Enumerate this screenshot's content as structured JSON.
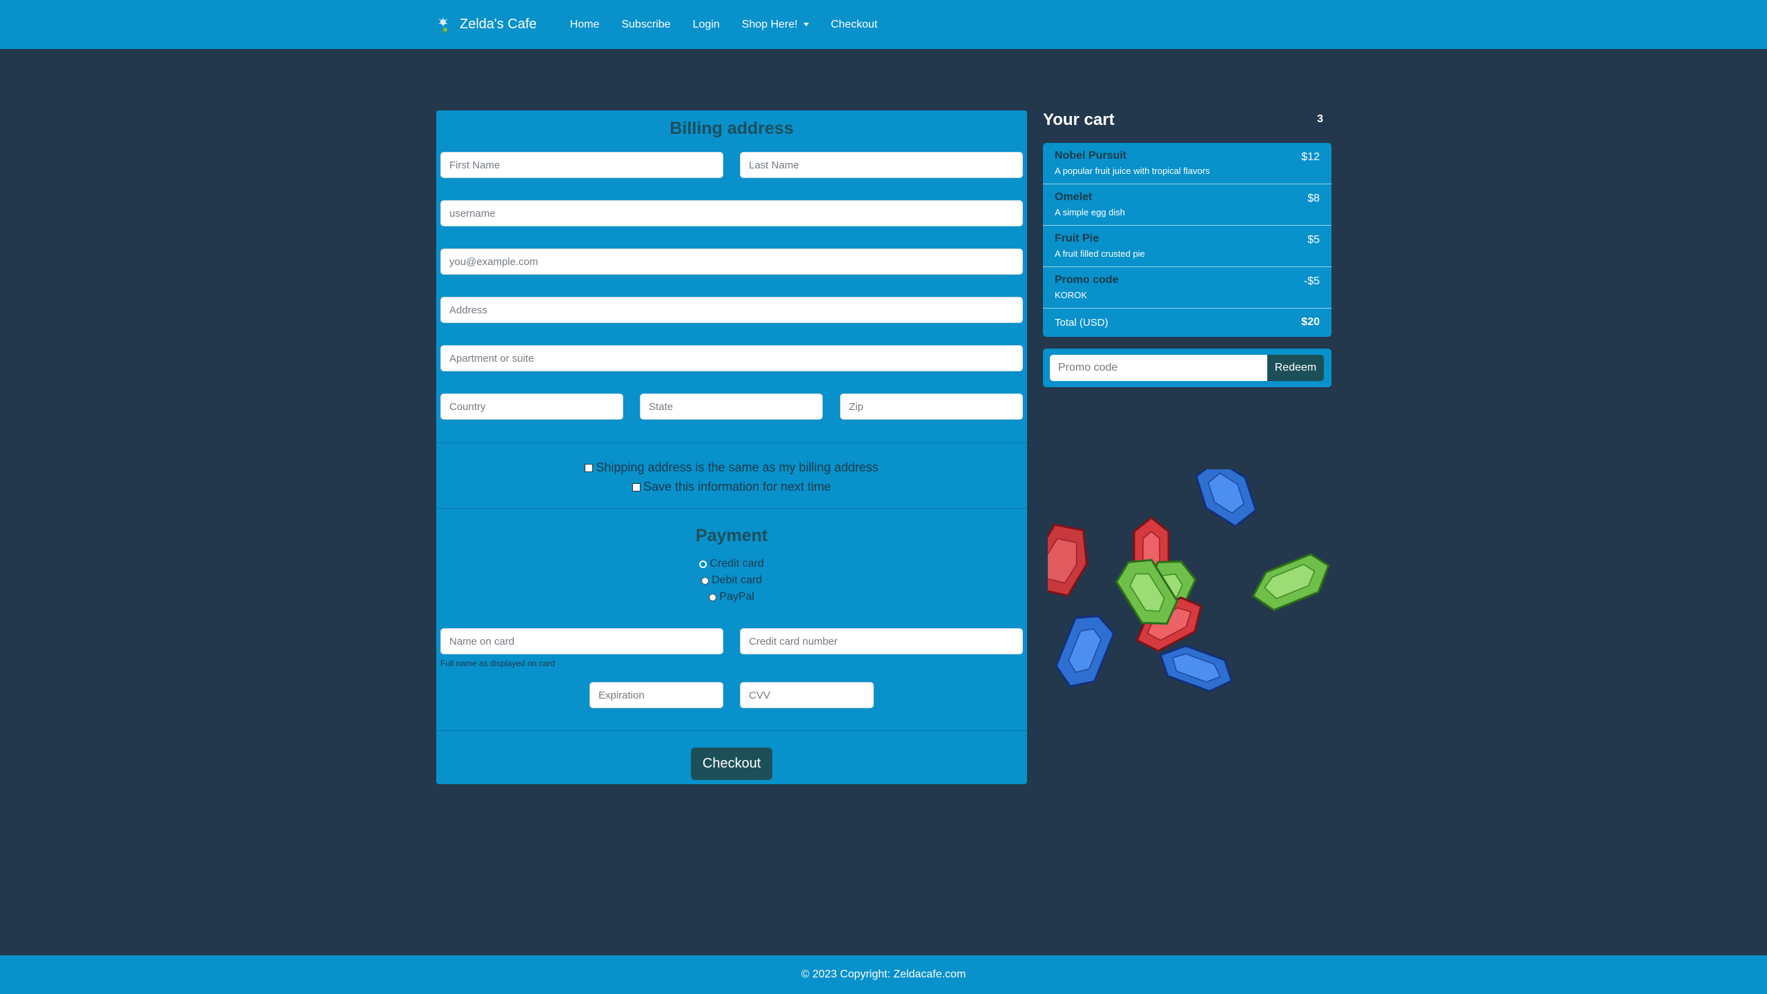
{
  "nav": {
    "brand": "Zelda's Cafe",
    "links": [
      "Home",
      "Subscribe",
      "Login",
      "Shop Here!",
      "Checkout"
    ]
  },
  "billing": {
    "title": "Billing address",
    "first_name": "First Name",
    "last_name": "Last Name",
    "username": "username",
    "email": "you@example.com",
    "address": "Address",
    "address2": "Apartment or suite",
    "country": "Country",
    "state": "State",
    "zip": "Zip",
    "same_address": "Shipping address is the same as my billing address",
    "save_info": "Save this information for next time"
  },
  "payment": {
    "title": "Payment",
    "methods": [
      "Credit card",
      "Debit card",
      "PayPal"
    ],
    "selected": "Credit card",
    "name_on_card": "Name on card",
    "name_help": "Full name as displayed on card",
    "card_number": "Credit card number",
    "expiration": "Expiration",
    "cvv": "CVV",
    "checkout": "Checkout"
  },
  "cart": {
    "title": "Your cart",
    "count": "3",
    "items": [
      {
        "name": "Nobel Pursuit",
        "desc": "A popular fruit juice with tropical flavors",
        "price": "$12"
      },
      {
        "name": "Omelet",
        "desc": "A simple egg dish",
        "price": "$8"
      },
      {
        "name": "Fruit Pie",
        "desc": "A fruit filled crusted pie",
        "price": "$5"
      },
      {
        "name": "Promo code",
        "desc": "KOROK",
        "price": "-$5"
      }
    ],
    "total_label": "Total (USD)",
    "total_value": "$20",
    "promo_placeholder": "Promo code",
    "redeem": "Redeem"
  },
  "footer": {
    "text": "© 2023 Copyright: Zeldacafe.com"
  },
  "colors": {
    "primary": "#0891cb",
    "background": "#23384c",
    "dark_button": "#1d4f58"
  }
}
